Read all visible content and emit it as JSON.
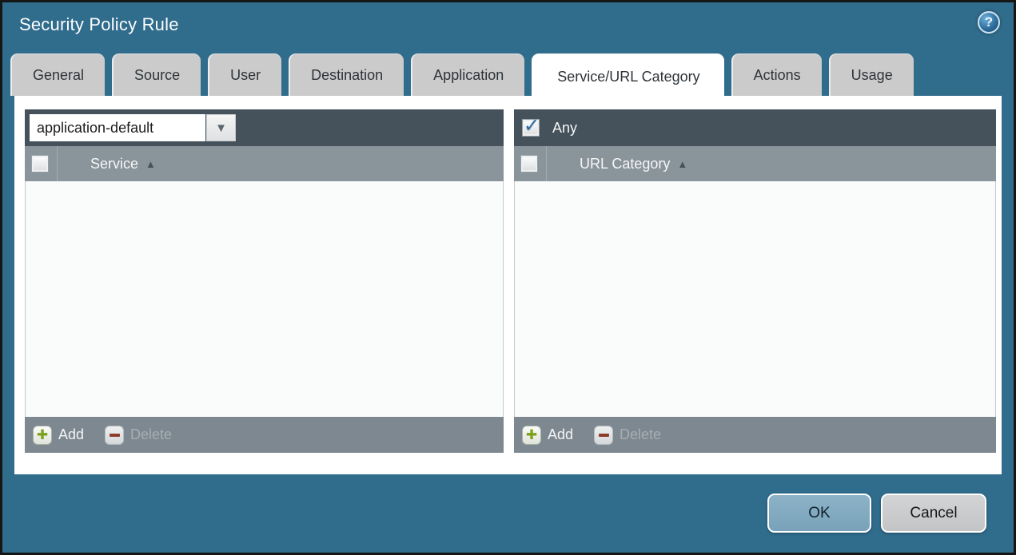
{
  "window": {
    "title": "Security Policy Rule"
  },
  "icons": {
    "help": "?",
    "check": "✓",
    "sort_asc": "▲",
    "dropdown_arrow": "▼",
    "add_plus": "✚"
  },
  "tabs": [
    {
      "label": "General",
      "active": false
    },
    {
      "label": "Source",
      "active": false
    },
    {
      "label": "User",
      "active": false
    },
    {
      "label": "Destination",
      "active": false
    },
    {
      "label": "Application",
      "active": false
    },
    {
      "label": "Service/URL Category",
      "active": true
    },
    {
      "label": "Actions",
      "active": false
    },
    {
      "label": "Usage",
      "active": false
    }
  ],
  "service_panel": {
    "dropdown_value": "application-default",
    "column_header": "Service",
    "add_label": "Add",
    "delete_label": "Delete",
    "rows": []
  },
  "url_category_panel": {
    "any_label": "Any",
    "any_checked": true,
    "column_header": "URL Category",
    "add_label": "Add",
    "delete_label": "Delete",
    "rows": []
  },
  "footer": {
    "ok_label": "OK",
    "cancel_label": "Cancel"
  },
  "colors": {
    "dialog_background": "#306c8c",
    "panel_dark_bar": "#45525c",
    "panel_header_bar": "#8a949b",
    "panel_footer_bar": "#7d8890",
    "list_background": "#fafbfb",
    "inactive_tab": "#cbcbcb",
    "ok_button": "#83abc2",
    "add_plus_green": "#7ba01c",
    "delete_minus_red": "#8d3c2c",
    "checkmark_blue": "#2b6ca6"
  }
}
